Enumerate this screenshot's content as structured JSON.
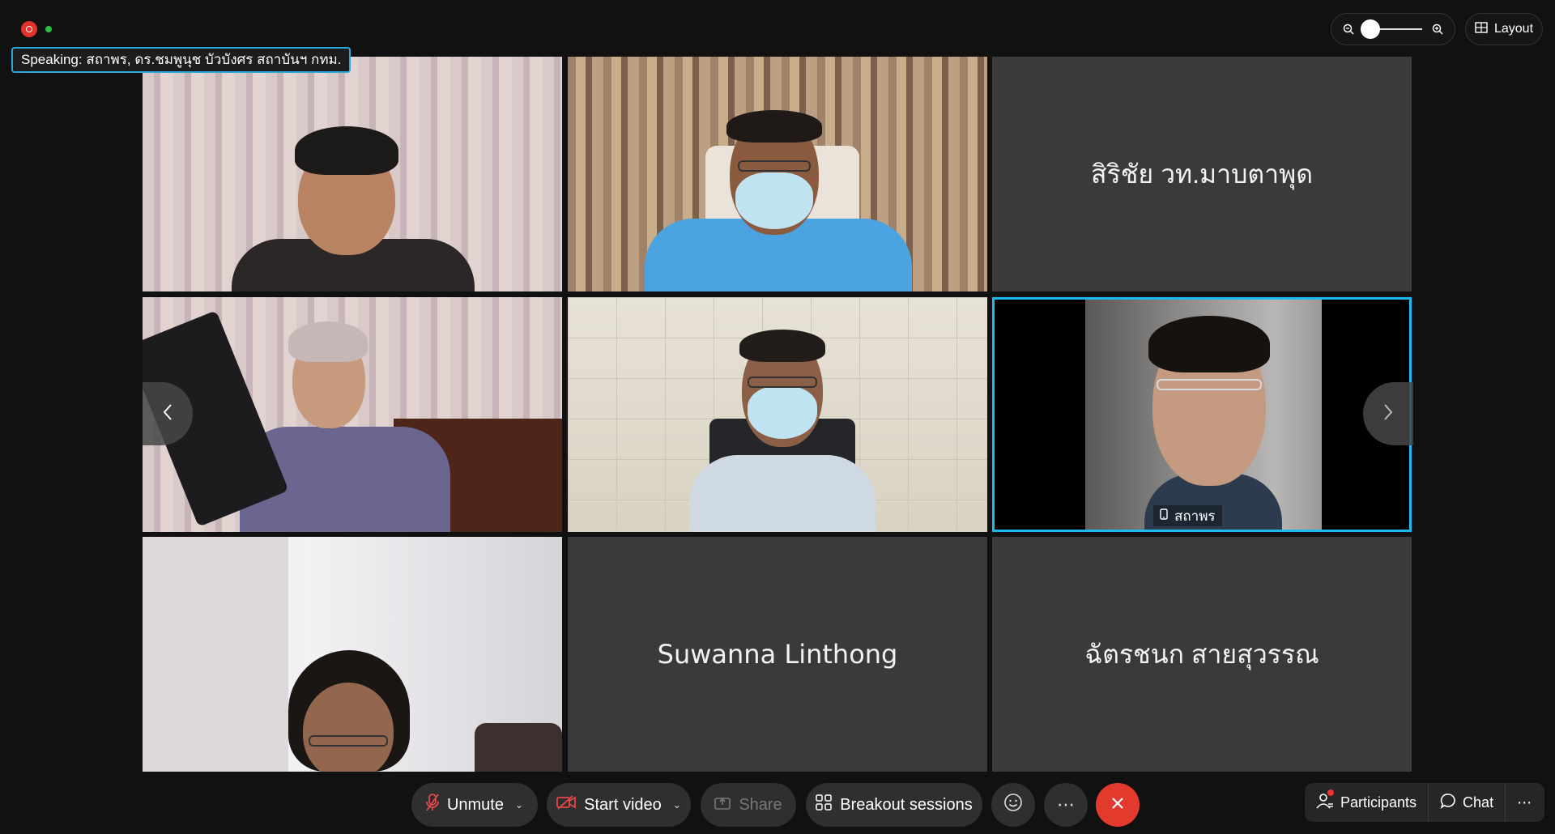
{
  "meeting": {
    "speaking_text": "Speaking: สถาพร, ดร.ชมพูนุช บัวบังศร สถาบันฯ กทม.",
    "layout_label": "Layout",
    "accent_color": "#1fb7f0",
    "recording_color": "#e0332b"
  },
  "participants": [
    {
      "id": "p1",
      "name": "",
      "video": true
    },
    {
      "id": "p2",
      "name": "",
      "video": true
    },
    {
      "id": "p3",
      "name": "สิริชัย วท.มาบตาพุด",
      "video": false
    },
    {
      "id": "p4",
      "name": "",
      "video": true
    },
    {
      "id": "p5",
      "name": "",
      "video": true
    },
    {
      "id": "p6",
      "name": "สถาพร",
      "video": true,
      "active_speaker": true
    },
    {
      "id": "p7",
      "name": "",
      "video": true
    },
    {
      "id": "p8",
      "name": "Suwanna Linthong",
      "video": false
    },
    {
      "id": "p9",
      "name": "ฉัตรชนก สายสุวรรณ",
      "video": false
    }
  ],
  "toolbar": {
    "unmute_label": "Unmute",
    "start_video_label": "Start video",
    "share_label": "Share",
    "breakout_label": "Breakout sessions",
    "participants_label": "Participants",
    "chat_label": "Chat"
  }
}
